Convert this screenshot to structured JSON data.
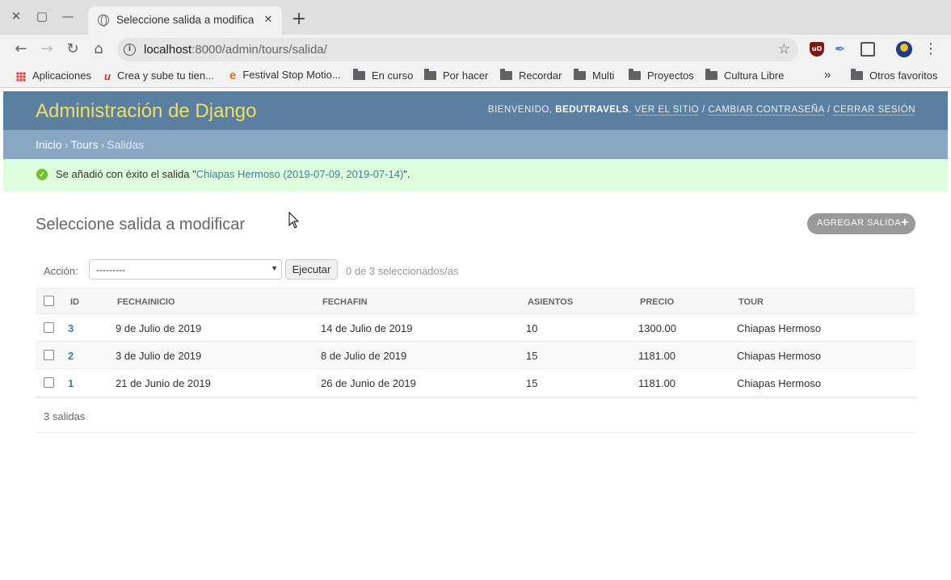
{
  "browser": {
    "tab_title": "Seleccione salida a modificar |",
    "url_host": "localhost",
    "url_rest": ":8000/admin/tours/salida/",
    "bookmarks": [
      {
        "label": "Aplicaciones",
        "icon": "apps-grid-icon"
      },
      {
        "label": "Crea y sube tu tien...",
        "icon": "site-v-icon"
      },
      {
        "label": "Festival Stop Motio...",
        "icon": "site-e-icon"
      },
      {
        "label": "En curso",
        "icon": "folder-icon"
      },
      {
        "label": "Por hacer",
        "icon": "folder-icon"
      },
      {
        "label": "Recordar",
        "icon": "folder-icon"
      },
      {
        "label": "Multi",
        "icon": "folder-icon"
      },
      {
        "label": "Proyectos",
        "icon": "folder-icon"
      },
      {
        "label": "Cultura Libre",
        "icon": "folder-icon"
      }
    ],
    "other_bookmarks": "Otros favoritos",
    "overflow": "»"
  },
  "admin": {
    "brand": "Administración de Django",
    "welcome": "Bienvenido,",
    "username": "BEDUTRAVELS",
    "view_site": "Ver el sitio",
    "change_password": "Cambiar contraseña",
    "logout": "Cerrar sesión",
    "breadcrumbs": {
      "home": "Inicio",
      "app": "Tours",
      "current": "Salidas"
    },
    "message": {
      "prefix": "Se añadió con éxito el salida \"",
      "object": "Chiapas Hermoso (2019-07-09, 2019-07-14)",
      "suffix": "\"."
    },
    "title": "Seleccione salida a modificar",
    "add_button": "Agregar salida",
    "actions": {
      "label": "Acción:",
      "selected": "---------",
      "go": "Ejecutar",
      "counter": "0 de 3 seleccionados/as"
    },
    "columns": [
      "ID",
      "FECHAINICIO",
      "FECHAFIN",
      "ASIENTOS",
      "PRECIO",
      "TOUR"
    ],
    "rows": [
      {
        "id": "3",
        "inicio": "9 de Julio de 2019",
        "fin": "14 de Julio de 2019",
        "asientos": "10",
        "precio": "1300.00",
        "tour": "Chiapas Hermoso"
      },
      {
        "id": "2",
        "inicio": "3 de Julio de 2019",
        "fin": "8 de Julio de 2019",
        "asientos": "15",
        "precio": "1181.00",
        "tour": "Chiapas Hermoso"
      },
      {
        "id": "1",
        "inicio": "21 de Junio de 2019",
        "fin": "26 de Junio de 2019",
        "asientos": "15",
        "precio": "1181.00",
        "tour": "Chiapas Hermoso"
      }
    ],
    "paginator": "3 salidas"
  }
}
